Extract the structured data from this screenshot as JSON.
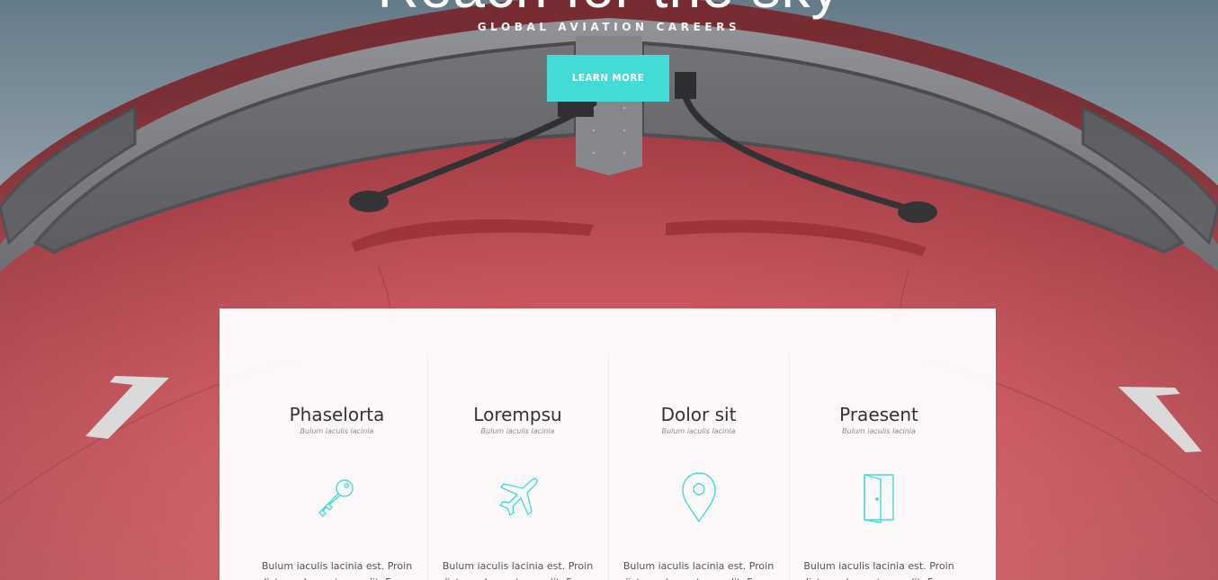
{
  "hero": {
    "title": "Reach for the sky",
    "subtitle": "GLOBAL AVIATION CAREERS",
    "cta_label": "LEARN MORE"
  },
  "colors": {
    "accent": "#43dbd5",
    "fuselage": "#c2404a",
    "sky": "#6f8795"
  },
  "features": [
    {
      "title": "Phaselorta",
      "subtitle": "Bulum iaculis lacinia",
      "icon": "key-icon",
      "text": "Bulum iaculis lacinia est. Proin dictum elementum velit. Fusce"
    },
    {
      "title": "Lorempsu",
      "subtitle": "Bulum iaculis lacinia",
      "icon": "airplane-icon",
      "text": "Bulum iaculis lacinia est. Proin dictum elementum velit. Fusce"
    },
    {
      "title": "Dolor sit",
      "subtitle": "Bulum iaculis lacinia",
      "icon": "map-pin-icon",
      "text": "Bulum iaculis lacinia est. Proin dictum elementum velit. Fusce"
    },
    {
      "title": "Praesent",
      "subtitle": "Bulum iaculis lacinia",
      "icon": "open-door-icon",
      "text": "Bulum iaculis lacinia est. Proin dictum elementum velit. Fusce"
    }
  ]
}
